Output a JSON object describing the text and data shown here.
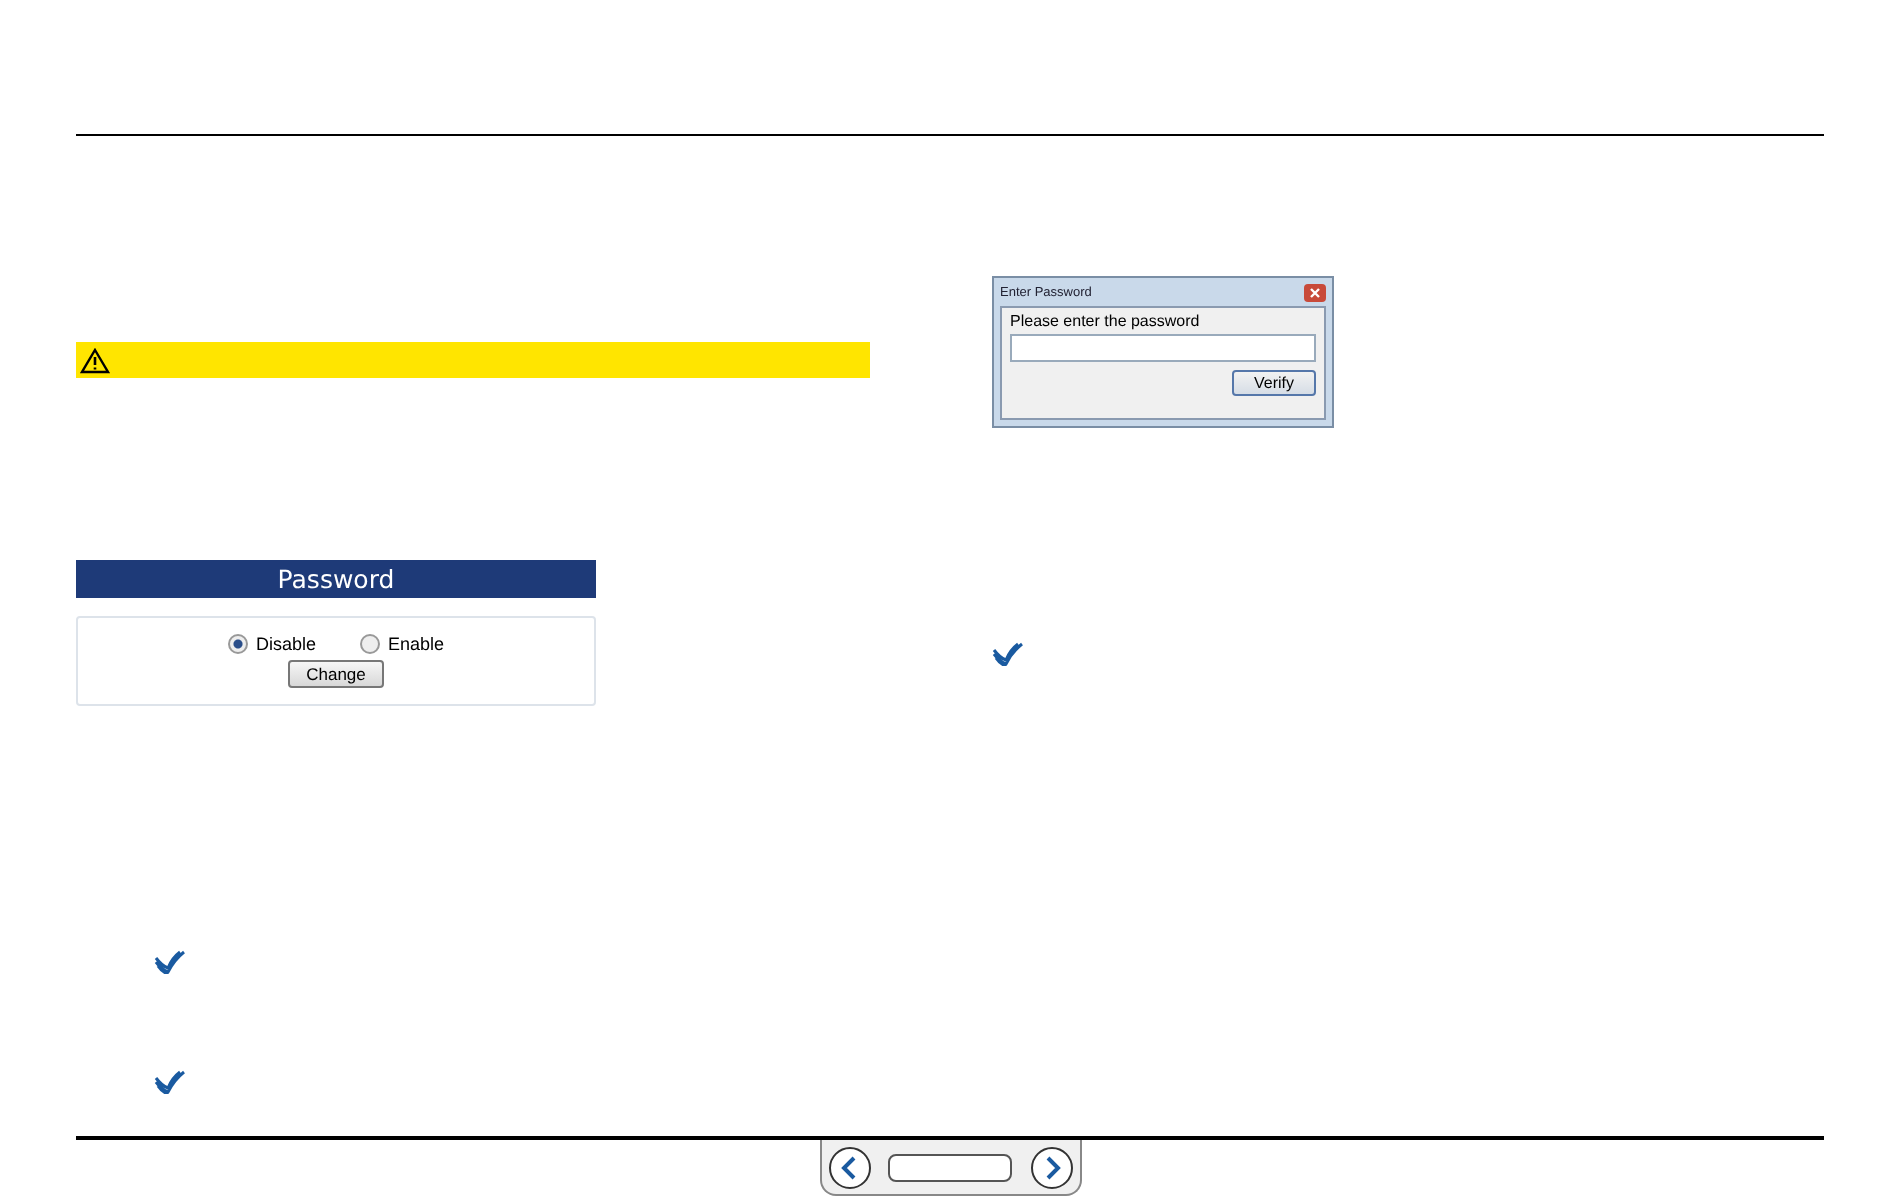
{
  "password_panel": {
    "title": "Password",
    "options": [
      {
        "label": "Disable",
        "selected": true
      },
      {
        "label": "Enable",
        "selected": false
      }
    ],
    "button": "Change"
  },
  "dialog": {
    "title": "Enter Password",
    "prompt": "Please enter the password",
    "button": "Verify"
  }
}
